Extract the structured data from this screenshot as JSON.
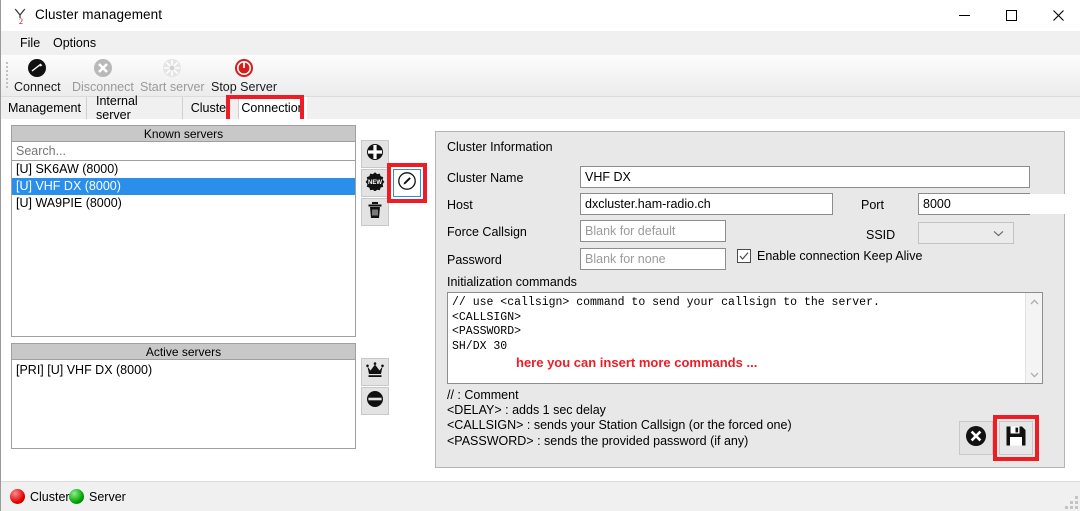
{
  "window": {
    "title": "Cluster management",
    "icon": "antenna-icon",
    "minimize_label": "—",
    "maximize_label": "□",
    "close_label": "✕"
  },
  "menubar": {
    "items": [
      {
        "label": "File",
        "name": "menu-file"
      },
      {
        "label": "Options",
        "name": "menu-options"
      }
    ]
  },
  "toolbar": {
    "buttons": [
      {
        "label": "Connect",
        "icon": "connect-icon",
        "enabled": true
      },
      {
        "label": "Disconnect",
        "icon": "disconnect-icon",
        "enabled": false
      },
      {
        "label": "Start server",
        "icon": "start-server-icon",
        "enabled": false
      },
      {
        "label": "Stop Server",
        "icon": "stop-server-icon",
        "enabled": true
      }
    ]
  },
  "tabs": {
    "items": [
      {
        "label": "Management",
        "active": false
      },
      {
        "label": "Internal server",
        "active": false
      },
      {
        "label": "Cluster",
        "active": false
      },
      {
        "label": "Connection",
        "active": true
      }
    ],
    "highlight_color": "#ee1c25"
  },
  "known_servers": {
    "title": "Known servers",
    "search_placeholder": "Search...",
    "search_value": "",
    "items": [
      {
        "label": "[U] SK6AW (8000)",
        "selected": false
      },
      {
        "label": "[U] VHF DX (8000)",
        "selected": true
      },
      {
        "label": "[U] WA9PIE (8000)",
        "selected": false
      }
    ],
    "selection_color": "#2a8fea",
    "buttons": [
      {
        "name": "add-server-button",
        "icon": "plus-circle-icon"
      },
      {
        "name": "new-server-button",
        "icon": "new-badge-icon"
      },
      {
        "name": "delete-server-button",
        "icon": "trash-icon"
      }
    ],
    "edit_button": {
      "name": "edit-server-button",
      "icon": "pencil-circle-icon",
      "highlighted": true
    }
  },
  "active_servers": {
    "title": "Active servers",
    "items": [
      {
        "label": "[PRI] [U] VHF DX (8000)"
      }
    ],
    "buttons": [
      {
        "name": "set-primary-button",
        "icon": "crown-icon"
      },
      {
        "name": "remove-active-button",
        "icon": "minus-circle-icon"
      }
    ]
  },
  "cluster_information": {
    "section_title": "Cluster Information",
    "fields": {
      "cluster_name": {
        "label": "Cluster Name",
        "value": "VHF DX",
        "placeholder": ""
      },
      "host": {
        "label": "Host",
        "value": "dxcluster.ham-radio.ch",
        "placeholder": ""
      },
      "port": {
        "label": "Port",
        "value": "8000"
      },
      "force_callsign": {
        "label": "Force Callsign",
        "value": "",
        "placeholder": "Blank for default"
      },
      "ssid": {
        "label": "SSID",
        "value": ""
      },
      "password": {
        "label": "Password",
        "value": "",
        "placeholder": "Blank for none"
      },
      "keep_alive": {
        "label": "Enable connection Keep Alive",
        "checked": true
      }
    },
    "init_commands": {
      "label": "Initialization commands",
      "text": "// use <callsign> command to send your callsign to the server.\n<CALLSIGN>\n<PASSWORD>\nSH/DX 30",
      "note": "here you can insert more commands ...",
      "note_color": "#ee1c25"
    },
    "legend": "// : Comment\n<DELAY> : adds 1 sec delay\n<CALLSIGN> : sends your Station Callsign (or the forced one)\n<PASSWORD> : sends the provided password (if any)",
    "buttons": [
      {
        "name": "cancel-button",
        "icon": "cancel-circle-icon",
        "highlighted": false
      },
      {
        "name": "save-button",
        "icon": "floppy-save-icon",
        "highlighted": true
      }
    ]
  },
  "statusbar": {
    "items": [
      {
        "label": "Cluster",
        "color": "#e00000"
      },
      {
        "label": "Server",
        "color": "#00a200"
      }
    ]
  }
}
